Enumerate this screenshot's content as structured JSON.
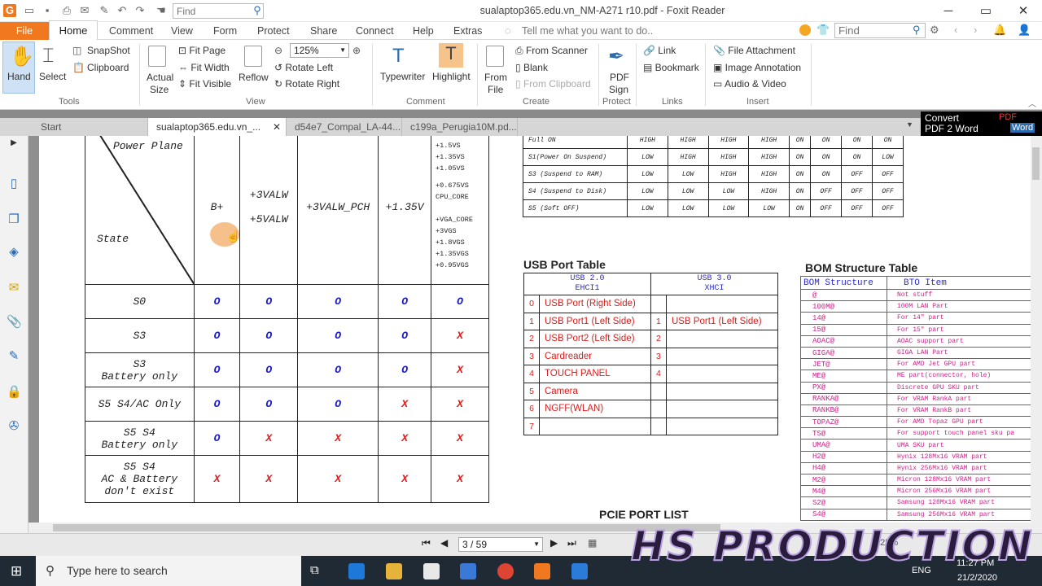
{
  "app": {
    "title": "sualaptop365.edu.vn_NM-A271 r10.pdf - Foxit Reader",
    "quick_find_placeholder": "Find",
    "find_placeholder": "Find",
    "tell_me": "Tell me what you want to do.."
  },
  "menu": {
    "file": "File",
    "tabs": [
      "Home",
      "Comment",
      "View",
      "Form",
      "Protect",
      "Share",
      "Connect",
      "Help",
      "Extras"
    ]
  },
  "ribbon": {
    "tools": {
      "hand": "Hand",
      "select": "Select",
      "snapshot": "SnapShot",
      "clipboard": "Clipboard",
      "group": "Tools"
    },
    "view": {
      "actual_size_1": "Actual",
      "actual_size_2": "Size",
      "fit_page": "Fit Page",
      "fit_width": "Fit Width",
      "fit_visible": "Fit Visible",
      "reflow": "Reflow",
      "zoom": "125%",
      "rotate_left": "Rotate Left",
      "rotate_right": "Rotate Right",
      "group": "View"
    },
    "comment": {
      "typewriter": "Typewriter",
      "highlight": "Highlight",
      "group": "Comment"
    },
    "create": {
      "from_file_1": "From",
      "from_file_2": "File",
      "from_scanner": "From Scanner",
      "blank": "Blank",
      "from_clipboard": "From Clipboard",
      "group": "Create"
    },
    "protect": {
      "pdf_sign_1": "PDF",
      "pdf_sign_2": "Sign",
      "group": "Protect"
    },
    "links": {
      "link": "Link",
      "bookmark": "Bookmark",
      "group": "Links"
    },
    "insert": {
      "file_attachment": "File Attachment",
      "image_annotation": "Image Annotation",
      "audio_video": "Audio & Video",
      "group": "Insert"
    }
  },
  "doc_tabs": [
    "Start",
    "sualaptop365.edu.vn_...",
    "d54e7_Compal_LA-44...",
    "c199a_Perugia10M.pd..."
  ],
  "convert": {
    "line1": "Convert",
    "line2": "PDF 2 Word",
    "pdf": "PDF",
    "word": "Word"
  },
  "power_table": {
    "header_top": "Power Plane",
    "header_state": "State",
    "columns": [
      "B+",
      "+3VALW",
      "+5VALW",
      "+3VALW_PCH",
      "+1.35V"
    ],
    "rail_list": [
      "+1.5VS",
      "+1.35VS",
      "+1.05VS",
      "+0.675VS",
      "CPU_CORE",
      "+VGA_CORE",
      "+3VGS",
      "+1.8VGS",
      "+1.35VGS",
      "+0.95VGS"
    ],
    "rows": [
      {
        "state": "S0",
        "state2": "",
        "vals": [
          "O",
          "O",
          "O",
          "O",
          "O"
        ]
      },
      {
        "state": "S3",
        "state2": "",
        "vals": [
          "O",
          "O",
          "O",
          "O",
          "X"
        ]
      },
      {
        "state": "S3",
        "state2": "Battery only",
        "vals": [
          "O",
          "O",
          "O",
          "O",
          "X"
        ]
      },
      {
        "state": "S5 S4/AC Only",
        "state2": "",
        "vals": [
          "O",
          "O",
          "O",
          "X",
          "X"
        ]
      },
      {
        "state": "S5 S4",
        "state2": "Battery only",
        "vals": [
          "O",
          "X",
          "X",
          "X",
          "X"
        ]
      },
      {
        "state": "S5 S4",
        "state2": "AC & Battery",
        "state3": "don't exist",
        "vals": [
          "X",
          "X",
          "X",
          "X",
          "X"
        ]
      }
    ]
  },
  "signal_table": {
    "rows": [
      {
        "name": "Full ON",
        "vals": [
          "HIGH",
          "HIGH",
          "HIGH",
          "HIGH",
          "ON",
          "ON",
          "ON",
          "ON"
        ]
      },
      {
        "name": "S1(Power On Suspend)",
        "vals": [
          "LOW",
          "HIGH",
          "HIGH",
          "HIGH",
          "ON",
          "ON",
          "ON",
          "LOW"
        ]
      },
      {
        "name": "S3 (Suspend to RAM)",
        "vals": [
          "LOW",
          "LOW",
          "HIGH",
          "HIGH",
          "ON",
          "ON",
          "OFF",
          "OFF"
        ]
      },
      {
        "name": "S4 (Suspend to Disk)",
        "vals": [
          "LOW",
          "LOW",
          "LOW",
          "HIGH",
          "ON",
          "OFF",
          "OFF",
          "OFF"
        ]
      },
      {
        "name": "S5 (Soft OFF)",
        "vals": [
          "LOW",
          "LOW",
          "LOW",
          "LOW",
          "ON",
          "OFF",
          "OFF",
          "OFF"
        ]
      }
    ]
  },
  "usb_table": {
    "title": "USB Port Table",
    "usb2_1": "USB 2.0",
    "usb2_2": "EHCI1",
    "usb3_1": "USB 3.0",
    "usb3_2": "XHCI",
    "rows": [
      {
        "n": "0",
        "port": "USB Port (Right Side)",
        "n3": "",
        "port3": ""
      },
      {
        "n": "1",
        "port": "USB Port1 (Left Side)",
        "n3": "1",
        "port3": "USB Port1 (Left Side)"
      },
      {
        "n": "2",
        "port": "USB Port2 (Left Side)",
        "n3": "2",
        "port3": ""
      },
      {
        "n": "3",
        "port": "Cardreader",
        "n3": "3",
        "port3": ""
      },
      {
        "n": "4",
        "port": "TOUCH PANEL",
        "n3": "4",
        "port3": ""
      },
      {
        "n": "5",
        "port": "Camera",
        "n3": "",
        "port3": ""
      },
      {
        "n": "6",
        "port": "NGFF(WLAN)",
        "n3": "",
        "port3": ""
      },
      {
        "n": "7",
        "port": "",
        "n3": "",
        "port3": ""
      }
    ]
  },
  "pcie_title": "PCIE PORT LIST",
  "bom_table": {
    "title": "BOM Structure Table",
    "col1": "BOM Structure",
    "col2": "BTO Item",
    "rows": [
      [
        "@",
        "Not stuff"
      ],
      [
        "100M@",
        "100M LAN Part"
      ],
      [
        "14@",
        "For 14\" part"
      ],
      [
        "15@",
        "For 15\" part"
      ],
      [
        "AOAC@",
        "AOAC support part"
      ],
      [
        "GIGA@",
        "GIGA LAN Part"
      ],
      [
        "JET@",
        "For AMD Jet GPU part"
      ],
      [
        "ME@",
        "ME part(connector, hole)"
      ],
      [
        "PX@",
        "Discrete GPU SKU part"
      ],
      [
        "RANKA@",
        "For VRAM RankA part"
      ],
      [
        "RANKB@",
        "For VRAM RankB part"
      ],
      [
        "TOPAZ@",
        "For AMD Topaz GPU part"
      ],
      [
        "TS@",
        "For support touch panel sku pa"
      ],
      [
        "UMA@",
        "UMA SKU part"
      ],
      [
        "H2@",
        "Hynix 128Mx16 VRAM part"
      ],
      [
        "H4@",
        "Hynix 256Mx16 VRAM part"
      ],
      [
        "M2@",
        "Micron 128Mx16 VRAM part"
      ],
      [
        "M4@",
        "Micron 256Mx16 VRAM part"
      ],
      [
        "S2@",
        "Samsung 128Mx16 VRAM part"
      ],
      [
        "S4@",
        "Samsung 256Mx16 VRAM part"
      ]
    ]
  },
  "status": {
    "page": "3 / 59",
    "zoom": "125%"
  },
  "watermark": "HS PRODUCTION",
  "taskbar": {
    "search": "Type here to search",
    "lang": "ENG",
    "time": "11:27 PM",
    "date": "21/2/2020"
  }
}
